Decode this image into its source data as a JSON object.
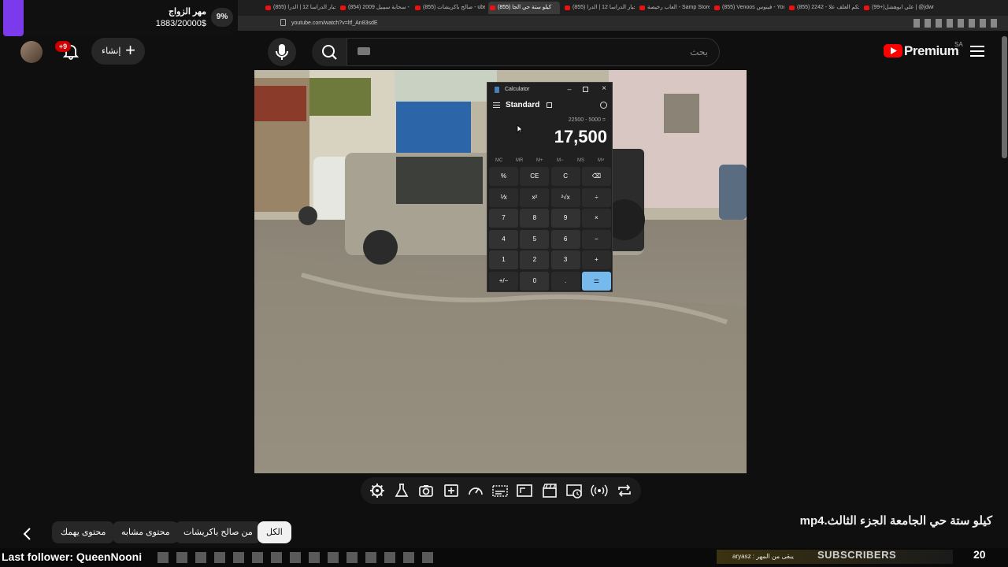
{
  "browser": {
    "tabs": [
      {
        "label": "(99+)علي ابوهشل | @jdwm",
        "active": false
      },
      {
        "label": "(855) 2242 - حكم العلف علا",
        "active": false
      },
      {
        "label": "(855) Venoos فينوس - You",
        "active": false
      },
      {
        "label": "العاب رخيصة - Samp Store",
        "active": false
      },
      {
        "label": "(855) اخبار الدراسا 12 | الدرا",
        "active": false
      },
      {
        "label": "(855) كيلو ستة حي الجا",
        "active": true
      },
      {
        "label": "(855) صالح باكريشات - ube",
        "active": false
      },
      {
        "label": "(854) سحابة سيبيل 2009 - ",
        "active": false
      },
      {
        "label": "(855) اخبار الدراسا 12 | الدرا",
        "active": false
      }
    ],
    "url": "youtube.com/watch?v=ltf_An83sdE",
    "colors": {
      "tab_favicon": "#e11d1d",
      "active_tab": "#3a3a3a"
    }
  },
  "overlay_goal": {
    "title": "مهر الزواج",
    "amount": "1883/20000$",
    "percent": "9%",
    "progress": 0.09,
    "accent": "#7c3aed"
  },
  "header": {
    "notifications_badge": "+9",
    "create_label": "إنشاء",
    "search_placeholder": "بحث",
    "logo_text": "Premium",
    "logo_country": "SA"
  },
  "calculator": {
    "title": "Calculator",
    "mode": "Standard",
    "expression": "22500 - 5000 =",
    "result": "17,500",
    "memory": [
      "MC",
      "MR",
      "M+",
      "M−",
      "MS",
      "M˅"
    ],
    "keys": [
      [
        "%",
        "CE",
        "C",
        "⌫"
      ],
      [
        "⅟x",
        "x²",
        "²√x",
        "÷"
      ],
      [
        "7",
        "8",
        "9",
        "×"
      ],
      [
        "4",
        "5",
        "6",
        "−"
      ],
      [
        "1",
        "2",
        "3",
        "+"
      ],
      [
        "+/−",
        "0",
        ".",
        "="
      ]
    ]
  },
  "chips": [
    {
      "label": "الكل",
      "selected": true
    },
    {
      "label": "من صالح باكريشات",
      "selected": false
    },
    {
      "label": "محتوى مشابه",
      "selected": false
    },
    {
      "label": "محتوى يهمك",
      "selected": false
    }
  ],
  "video": {
    "title": "كيلو ستة حي الجامعة الجزء الثالث.mp4"
  },
  "stream": {
    "last_follower": "Last follower: QueenNooni",
    "ticker": "aryasz : يبقى من المهر",
    "subscribers_label": "SUBSCRIBERS",
    "subscribers_count": "20"
  },
  "icons": [
    "gear-icon",
    "flask-icon",
    "camera-icon",
    "add-clip-icon",
    "speedometer-icon",
    "subtitles-icon",
    "aspect-ratio-icon",
    "clapperboard-icon",
    "watch-later-icon",
    "broadcast-icon",
    "loop-icon"
  ]
}
